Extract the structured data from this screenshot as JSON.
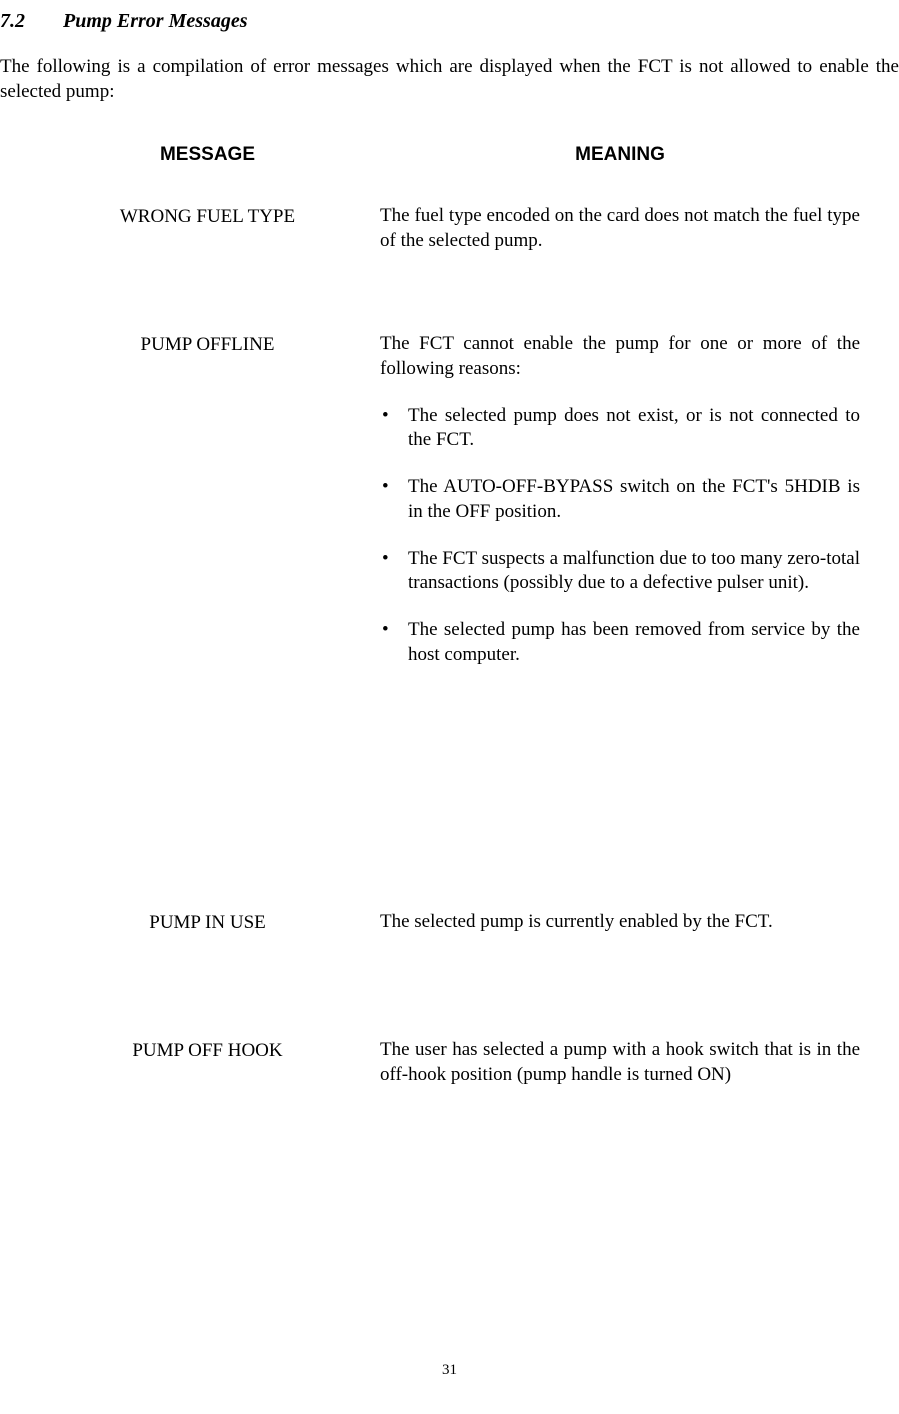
{
  "section": {
    "number": "7.2",
    "title": "Pump Error Messages"
  },
  "intro": "The following is a compilation of error messages which are displayed when the FCT is not allowed to enable the selected pump:",
  "headers": {
    "message": "MESSAGE",
    "meaning": "MEANING"
  },
  "rows": {
    "wrong_fuel": {
      "message": "WRONG FUEL TYPE",
      "meaning": "The fuel type encoded on the card does not match the fuel type of the selected pump."
    },
    "pump_offline": {
      "message": "PUMP OFFLINE",
      "meaning": "The FCT cannot enable the pump for one or more of the following reasons:",
      "bullets": {
        "b1": "The selected pump does not exist, or is not connected to the FCT.",
        "b2": "The AUTO-OFF-BYPASS switch on the FCT's 5HDIB is in the OFF position.",
        "b3": "The FCT suspects a malfunction due to too many zero-total transactions (possibly due to a defective pulser unit).",
        "b4": "The selected pump has been removed from service by the host computer."
      }
    },
    "pump_in_use": {
      "message": "PUMP IN USE",
      "meaning": "The selected pump is currently enabled by the FCT."
    },
    "pump_off_hook": {
      "message": "PUMP OFF HOOK",
      "meaning": "The user has selected a pump with a hook switch that is in the off-hook position (pump handle is turned ON)"
    }
  },
  "page_number": "31"
}
